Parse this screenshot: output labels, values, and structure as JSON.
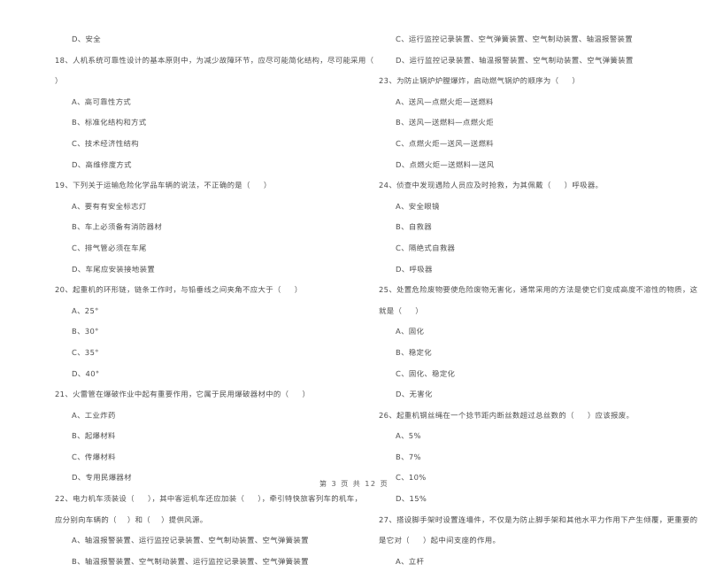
{
  "document": {
    "page_label": "第 3 页 共 12 页",
    "text_color": "#4a4a4a",
    "background_color": "#ffffff"
  },
  "left_column": {
    "blocks": [
      {
        "type": "option",
        "lines": [
          "D、安全"
        ]
      },
      {
        "type": "question",
        "number": "18",
        "lines": [
          "18、人机系统可靠性设计的基本原则中，为减少故障环节，应尽可能简化结构，尽可能采用（",
          "）"
        ]
      },
      {
        "type": "option",
        "lines": [
          "A、高可靠性方式"
        ]
      },
      {
        "type": "option",
        "lines": [
          "B、标准化结构和方式"
        ]
      },
      {
        "type": "option",
        "lines": [
          "C、技术经济性结构"
        ]
      },
      {
        "type": "option",
        "lines": [
          "D、高维修度方式"
        ]
      },
      {
        "type": "question",
        "number": "19",
        "lines": [
          "19、下列关于运输危险化学品车辆的说法，不正确的是（     ）"
        ]
      },
      {
        "type": "option",
        "lines": [
          "A、要有有安全标志灯"
        ]
      },
      {
        "type": "option",
        "lines": [
          "B、车上必须备有消防器材"
        ]
      },
      {
        "type": "option",
        "lines": [
          "C、排气管必须在车尾"
        ]
      },
      {
        "type": "option",
        "lines": [
          "D、车尾应安装接地装置"
        ]
      },
      {
        "type": "question",
        "number": "20",
        "lines": [
          "20、起重机的环形链，链条工作时，与铅垂线之间夹角不应大于（     ）"
        ]
      },
      {
        "type": "option",
        "lines": [
          "A、25°"
        ]
      },
      {
        "type": "option",
        "lines": [
          "B、30°"
        ]
      },
      {
        "type": "option",
        "lines": [
          "C、35°"
        ]
      },
      {
        "type": "option",
        "lines": [
          "D、40°"
        ]
      },
      {
        "type": "question",
        "number": "21",
        "lines": [
          "21、火雷管在爆破作业中起有重要作用，它属于民用爆破器材中的（     ）"
        ]
      },
      {
        "type": "option",
        "lines": [
          "A、工业炸药"
        ]
      },
      {
        "type": "option",
        "lines": [
          "B、起爆材料"
        ]
      },
      {
        "type": "option",
        "lines": [
          "C、传爆材料"
        ]
      },
      {
        "type": "option",
        "lines": [
          "D、专用民爆器材"
        ]
      },
      {
        "type": "question",
        "number": "22",
        "lines": [
          "22、电力机车须装设（     ），其中客运机车还应加装（     ），牵引特快旅客列车的机车，",
          "应分别向车辆的（    ）和（    ）提供风源。"
        ]
      },
      {
        "type": "option",
        "lines": [
          "A、轴温报警装置、运行监控记录装置、空气制动装置、空气弹簧装置"
        ]
      },
      {
        "type": "option",
        "lines": [
          "B、轴温报警装置、空气制动装置、运行监控记录装置、空气弹簧装置"
        ]
      }
    ]
  },
  "right_column": {
    "blocks": [
      {
        "type": "option",
        "lines": [
          "C、运行监控记录装置、空气弹簧装置、空气制动装置、轴温报警装置"
        ]
      },
      {
        "type": "option",
        "lines": [
          "D、运行监控记录装置、轴温报警装置、空气制动装置、空气弹簧装置"
        ]
      },
      {
        "type": "question",
        "number": "23",
        "lines": [
          "23、为防止锅炉炉膛爆炸，启动燃气锅炉的顺序为（     ）"
        ]
      },
      {
        "type": "option",
        "lines": [
          "A、送风—点燃火炬—送燃料"
        ]
      },
      {
        "type": "option",
        "lines": [
          "B、送风—送燃料—点燃火炬"
        ]
      },
      {
        "type": "option",
        "lines": [
          "C、点燃火炬—送风—送燃料"
        ]
      },
      {
        "type": "option",
        "lines": [
          "D、点燃火炬—送燃料—送风"
        ]
      },
      {
        "type": "question",
        "number": "24",
        "lines": [
          "24、侦查中发现遇险人员应及时抢救，为其佩戴（     ）呼吸器。"
        ]
      },
      {
        "type": "option",
        "lines": [
          "A、安全眼镜"
        ]
      },
      {
        "type": "option",
        "lines": [
          "B、自救器"
        ]
      },
      {
        "type": "option",
        "lines": [
          "C、隔绝式自救器"
        ]
      },
      {
        "type": "option",
        "lines": [
          "D、呼吸器"
        ]
      },
      {
        "type": "question",
        "number": "25",
        "lines": [
          "25、处置危险废物要使危险废物无害化，通常采用的方法是使它们变成高度不溶性的物质，这",
          "就是（     ）"
        ]
      },
      {
        "type": "option",
        "lines": [
          "A、固化"
        ]
      },
      {
        "type": "option",
        "lines": [
          "B、稳定化"
        ]
      },
      {
        "type": "option",
        "lines": [
          "C、固化、稳定化"
        ]
      },
      {
        "type": "option",
        "lines": [
          "D、无害化"
        ]
      },
      {
        "type": "question",
        "number": "26",
        "lines": [
          "26、起重机钢丝绳在一个捻节距内断丝数超过总丝数的（     ）应该报废。"
        ]
      },
      {
        "type": "option",
        "lines": [
          "A、5%"
        ]
      },
      {
        "type": "option",
        "lines": [
          "B、7%"
        ]
      },
      {
        "type": "option",
        "lines": [
          "C、10%"
        ]
      },
      {
        "type": "option",
        "lines": [
          "D、15%"
        ]
      },
      {
        "type": "question",
        "number": "27",
        "lines": [
          "27、搭设脚手架时设置连墙件，不仅是为防止脚手架和其他水平力作用下产生倾覆，更重要的",
          "是它对（     ）起中间支座的作用。"
        ]
      },
      {
        "type": "option",
        "lines": [
          "A、立杆"
        ]
      }
    ]
  }
}
